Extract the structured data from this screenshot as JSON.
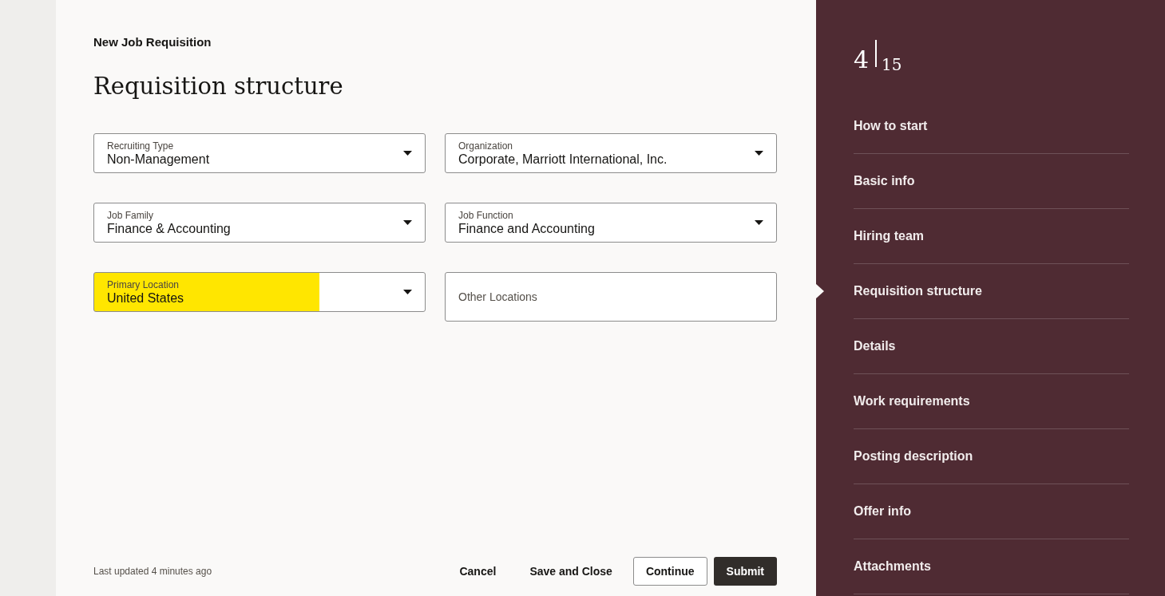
{
  "header": {
    "subtitle": "New Job Requisition",
    "title": "Requisition structure"
  },
  "fields": [
    {
      "kind": "select",
      "label": "Recruiting Type",
      "value": "Non-Management",
      "highlighted": false
    },
    {
      "kind": "select",
      "label": "Organization",
      "value": "Corporate, Marriott International, Inc.",
      "highlighted": false
    },
    {
      "kind": "select",
      "label": "Job Family",
      "value": "Finance & Accounting",
      "highlighted": false
    },
    {
      "kind": "select",
      "label": "Job Function",
      "value": "Finance and Accounting",
      "highlighted": false
    },
    {
      "kind": "select",
      "label": "Primary Location",
      "value": "United States",
      "highlighted": true
    },
    {
      "kind": "text",
      "placeholder": "Other Locations",
      "highlighted": false
    }
  ],
  "footer": {
    "status": "Last updated 4 minutes ago",
    "buttons": [
      {
        "label": "Cancel",
        "kind": "text"
      },
      {
        "label": "Save and Close",
        "kind": "text"
      },
      {
        "label": "Continue",
        "kind": "outline"
      },
      {
        "label": "Submit",
        "kind": "primary"
      }
    ]
  },
  "steps": {
    "current": "4",
    "total": "15",
    "items": [
      {
        "label": "How to start",
        "selected": false
      },
      {
        "label": "Basic info",
        "selected": false
      },
      {
        "label": "Hiring team",
        "selected": false
      },
      {
        "label": "Requisition structure",
        "selected": true
      },
      {
        "label": "Details",
        "selected": false
      },
      {
        "label": "Work requirements",
        "selected": false
      },
      {
        "label": "Posting description",
        "selected": false
      },
      {
        "label": "Offer info",
        "selected": false
      },
      {
        "label": "Attachments",
        "selected": false
      }
    ]
  }
}
